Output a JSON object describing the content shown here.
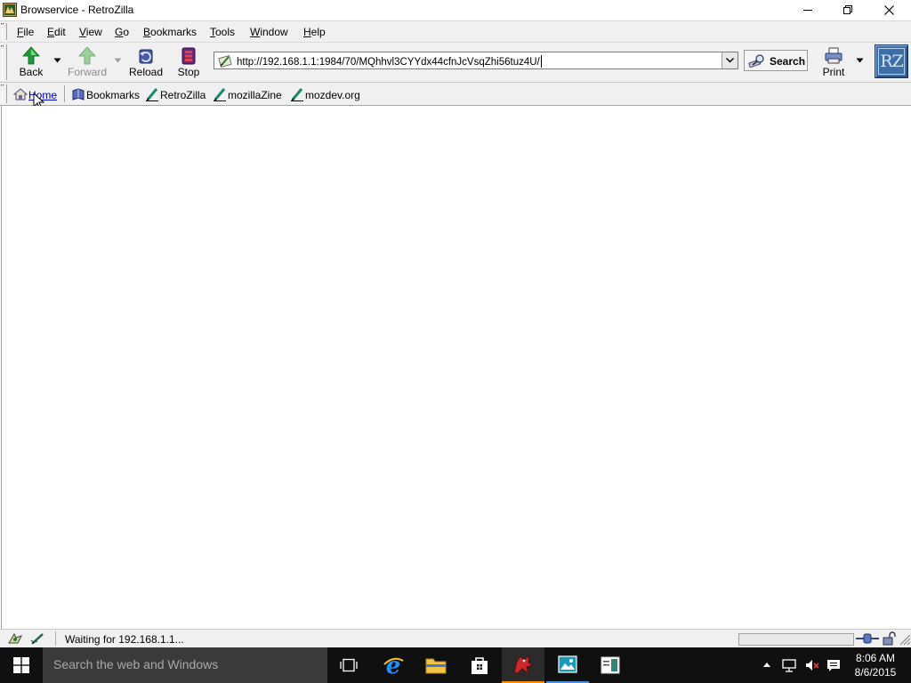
{
  "window": {
    "title": "Browservice - RetroZilla"
  },
  "menu": {
    "items": [
      {
        "label": "File",
        "accel": "F",
        "rest": "ile"
      },
      {
        "label": "Edit",
        "accel": "E",
        "rest": "dit"
      },
      {
        "label": "View",
        "accel": "V",
        "rest": "iew"
      },
      {
        "label": "Go",
        "accel": "G",
        "rest": "o"
      },
      {
        "label": "Bookmarks",
        "accel": "B",
        "rest": "ookmarks"
      },
      {
        "label": "Tools",
        "accel": "T",
        "rest": "ools"
      },
      {
        "label": "Window",
        "accel": "W",
        "rest": "indow"
      },
      {
        "label": "Help",
        "accel": "H",
        "rest": "elp"
      }
    ]
  },
  "navigation": {
    "back_label": "Back",
    "forward_label": "Forward",
    "reload_label": "Reload",
    "stop_label": "Stop",
    "url": "http://192.168.1.1:1984/70/MQhhvl3CYYdx44cfnJcVsqZhi56tuz4U/",
    "search_label": "Search",
    "print_label": "Print",
    "logo_text": "RZ"
  },
  "personal_toolbar": {
    "home_label": "Home",
    "bookmarks": [
      {
        "label": "Bookmarks"
      },
      {
        "label": "RetroZilla"
      },
      {
        "label": "mozillaZine"
      },
      {
        "label": "mozdev.org"
      }
    ]
  },
  "status": {
    "text": "Waiting for 192.168.1.1..."
  },
  "taskbar": {
    "search_placeholder": "Search the web and Windows",
    "time": "8:06 AM",
    "date": "8/6/2015"
  },
  "colors": {
    "taskbar_bg": "#101010",
    "accent_active": "#ff8c00",
    "link": "#0000cc"
  }
}
